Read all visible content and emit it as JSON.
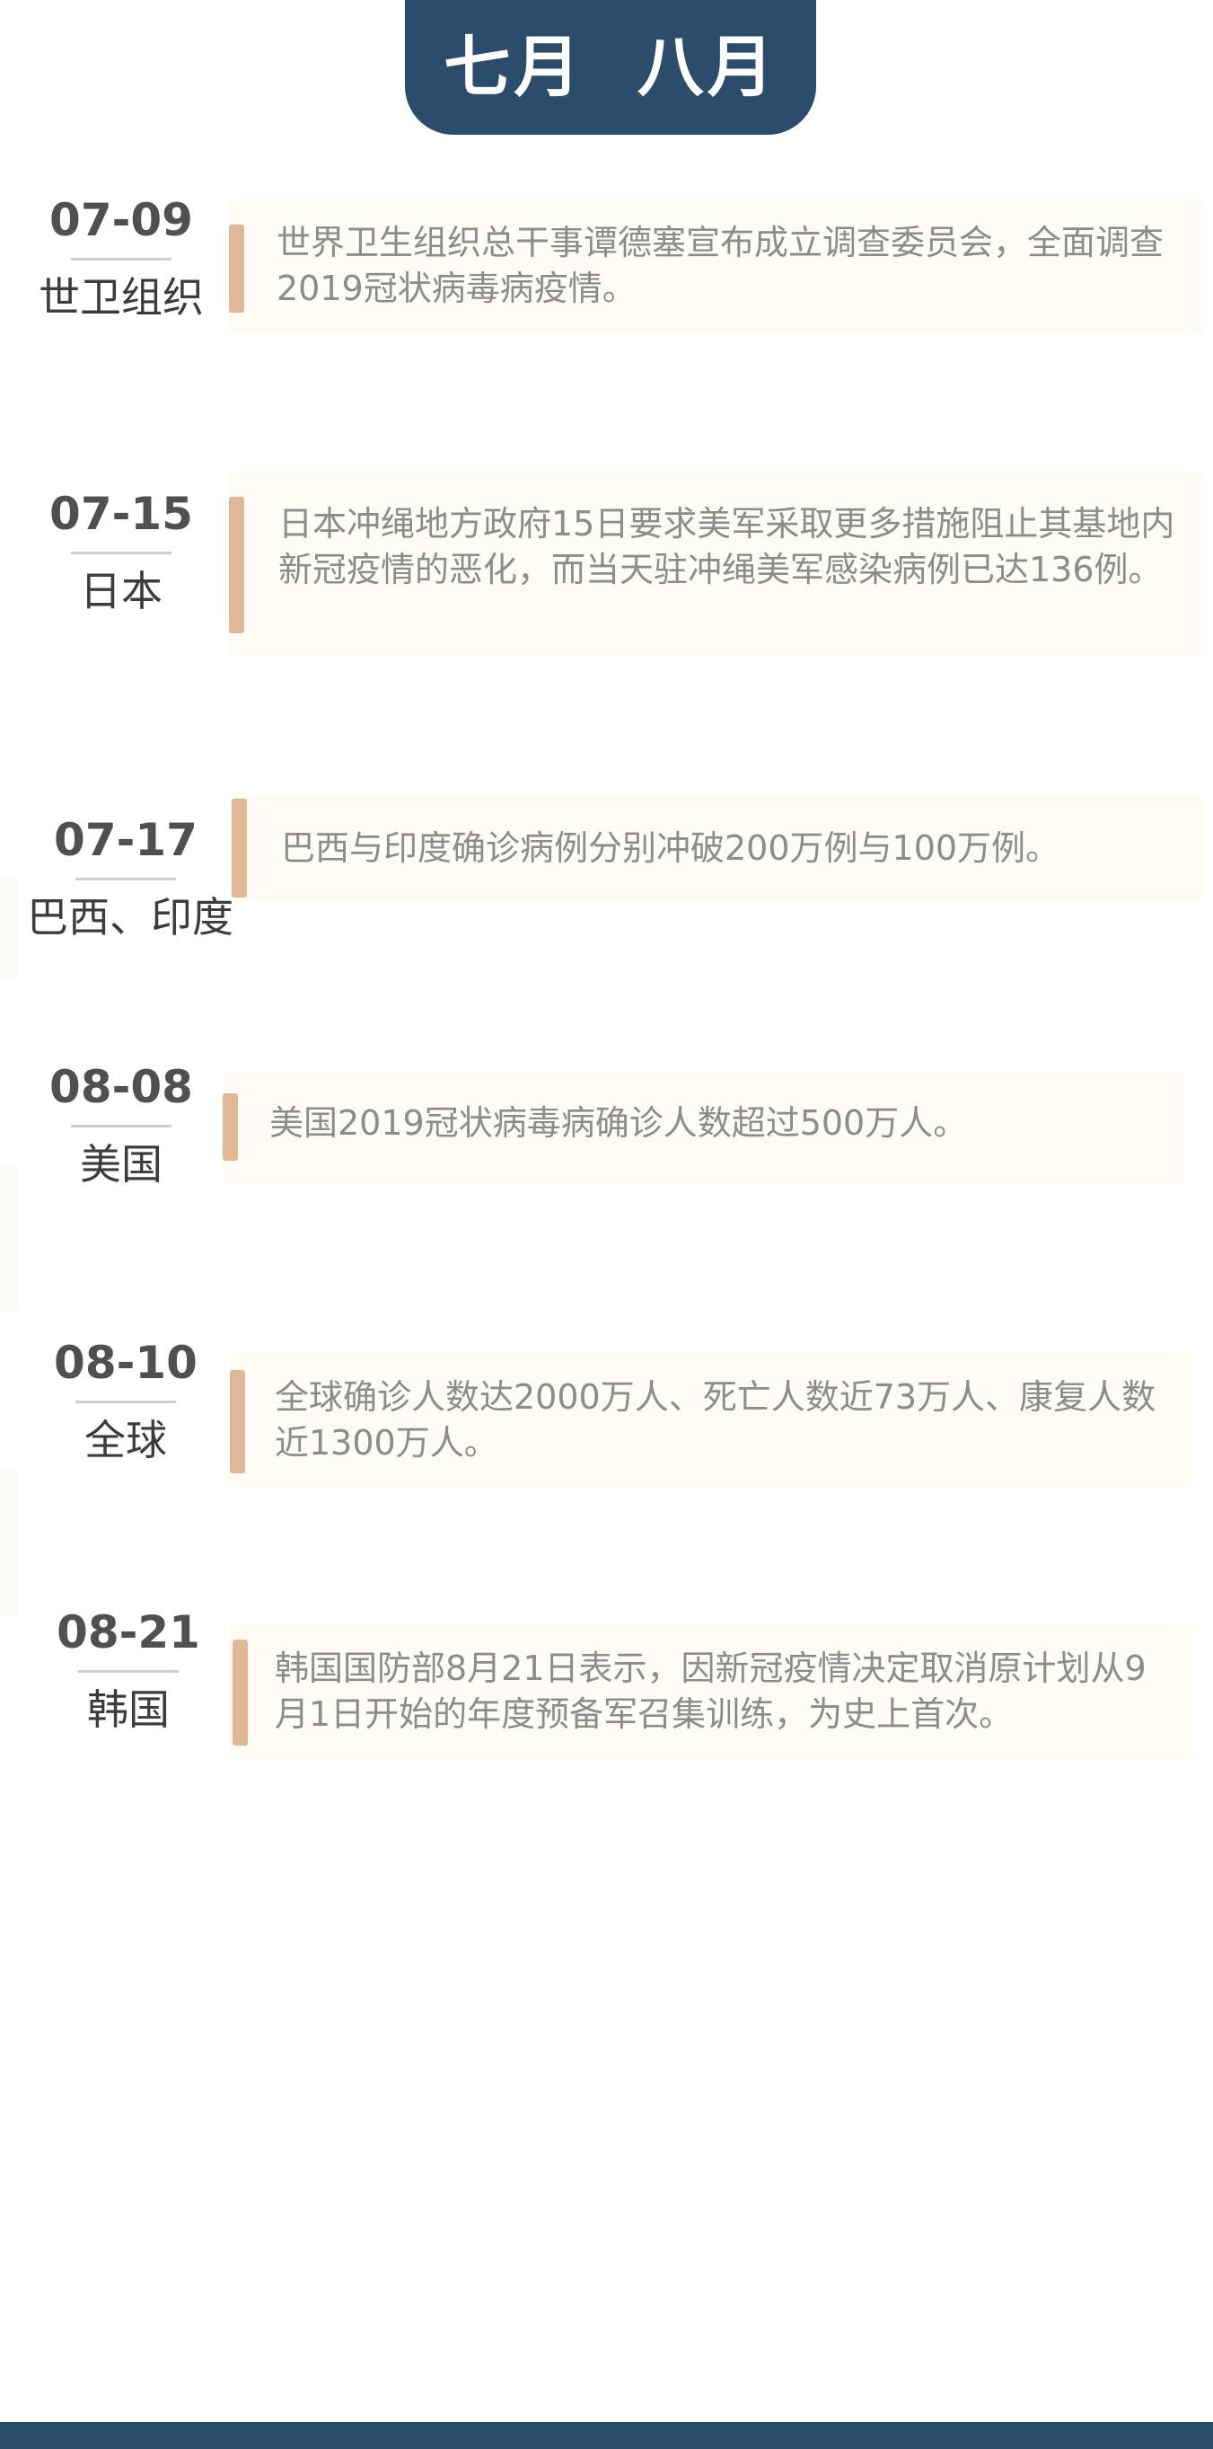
{
  "header": {
    "title": "七月  八月"
  },
  "entries": [
    {
      "date": "07-09",
      "region": "世卫组织",
      "text": "世界卫生组织总干事谭德塞宣布成立调查委员会，全面调查2019冠状病毒病疫情。"
    },
    {
      "date": "07-15",
      "region": "日本",
      "text": "日本冲绳地方政府15日要求美军采取更多措施阻止其基地内新冠疫情的恶化，而当天驻冲绳美军感染病例已达136例。"
    },
    {
      "date": "07-17",
      "region": "巴西、印度",
      "text": "巴西与印度确诊病例分别冲破200万例与100万例。"
    },
    {
      "date": "08-08",
      "region": "美国",
      "text": "美国2019冠状病毒病确诊人数超过500万人。"
    },
    {
      "date": "08-10",
      "region": "全球",
      "text": "全球确诊人数达2000万人、死亡人数近73万人、康复人数近1300万人。"
    },
    {
      "date": "08-21",
      "region": "韩国",
      "text": "韩国国防部8月21日表示，因新冠疫情决定取消原计划从9月1日开始的年度预备军召集训练，为史上首次。"
    }
  ]
}
